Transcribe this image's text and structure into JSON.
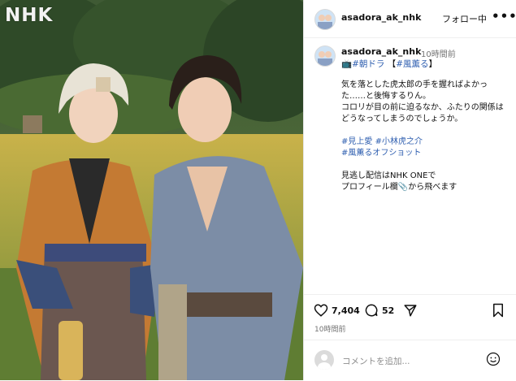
{
  "photo": {
    "watermark": "NHK"
  },
  "header": {
    "username": "asadora_ak_nhk",
    "follow_label": "フォロー中",
    "more_label": "•••"
  },
  "caption": {
    "username": "asadora_ak_nhk",
    "time": "10時間前",
    "tag_program": "#朝ドラ",
    "bracket_open": "【",
    "tag_title": "#風薫る",
    "bracket_close": "】",
    "line1": "気を落とした虎太郎の手を握ればよかった……と後悔するりん。",
    "line2": "コロリが目の前に迫るなか、ふたりの関係はどうなってしまうのでしょうか。",
    "hashtag1": "#見上愛",
    "hashtag2": "#小林虎之介",
    "hashtag3": "#風薫るオフショット",
    "line3": "見逃し配信はNHK ONEで",
    "line4": "プロフィール欄📎から飛べます"
  },
  "actions": {
    "likes": "7,404",
    "comments": "52"
  },
  "post_time": "10時間前",
  "comment_box": {
    "placeholder": "コメントを追加..."
  },
  "icons": [
    "heart-icon",
    "comment-icon",
    "share-icon",
    "bookmark-icon",
    "emoji-icon",
    "more-icon"
  ],
  "colors": {
    "link": "#2f5fb0",
    "muted": "#737373"
  }
}
